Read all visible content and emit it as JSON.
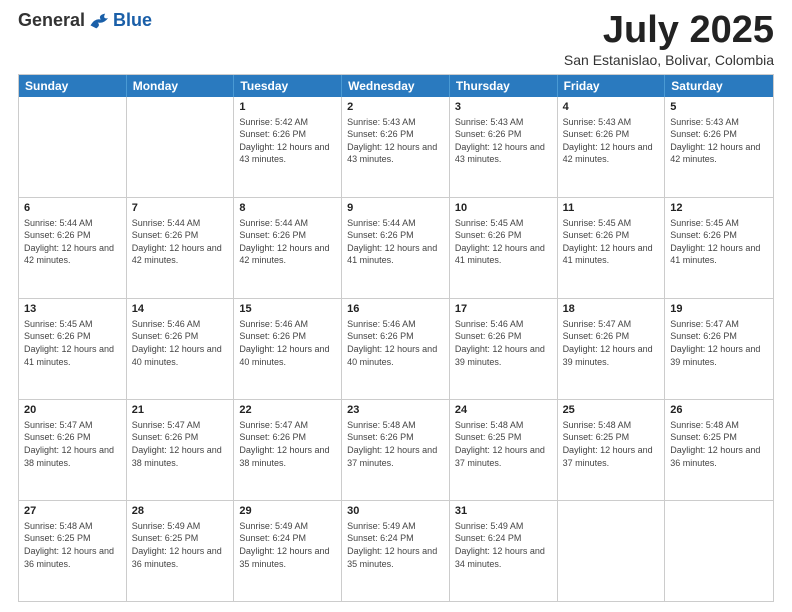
{
  "logo": {
    "general": "General",
    "blue": "Blue"
  },
  "title": "July 2025",
  "subtitle": "San Estanislao, Bolivar, Colombia",
  "header_days": [
    "Sunday",
    "Monday",
    "Tuesday",
    "Wednesday",
    "Thursday",
    "Friday",
    "Saturday"
  ],
  "weeks": [
    [
      {
        "day": "",
        "info": ""
      },
      {
        "day": "",
        "info": ""
      },
      {
        "day": "1",
        "info": "Sunrise: 5:42 AM\nSunset: 6:26 PM\nDaylight: 12 hours and 43 minutes."
      },
      {
        "day": "2",
        "info": "Sunrise: 5:43 AM\nSunset: 6:26 PM\nDaylight: 12 hours and 43 minutes."
      },
      {
        "day": "3",
        "info": "Sunrise: 5:43 AM\nSunset: 6:26 PM\nDaylight: 12 hours and 43 minutes."
      },
      {
        "day": "4",
        "info": "Sunrise: 5:43 AM\nSunset: 6:26 PM\nDaylight: 12 hours and 42 minutes."
      },
      {
        "day": "5",
        "info": "Sunrise: 5:43 AM\nSunset: 6:26 PM\nDaylight: 12 hours and 42 minutes."
      }
    ],
    [
      {
        "day": "6",
        "info": "Sunrise: 5:44 AM\nSunset: 6:26 PM\nDaylight: 12 hours and 42 minutes."
      },
      {
        "day": "7",
        "info": "Sunrise: 5:44 AM\nSunset: 6:26 PM\nDaylight: 12 hours and 42 minutes."
      },
      {
        "day": "8",
        "info": "Sunrise: 5:44 AM\nSunset: 6:26 PM\nDaylight: 12 hours and 42 minutes."
      },
      {
        "day": "9",
        "info": "Sunrise: 5:44 AM\nSunset: 6:26 PM\nDaylight: 12 hours and 41 minutes."
      },
      {
        "day": "10",
        "info": "Sunrise: 5:45 AM\nSunset: 6:26 PM\nDaylight: 12 hours and 41 minutes."
      },
      {
        "day": "11",
        "info": "Sunrise: 5:45 AM\nSunset: 6:26 PM\nDaylight: 12 hours and 41 minutes."
      },
      {
        "day": "12",
        "info": "Sunrise: 5:45 AM\nSunset: 6:26 PM\nDaylight: 12 hours and 41 minutes."
      }
    ],
    [
      {
        "day": "13",
        "info": "Sunrise: 5:45 AM\nSunset: 6:26 PM\nDaylight: 12 hours and 41 minutes."
      },
      {
        "day": "14",
        "info": "Sunrise: 5:46 AM\nSunset: 6:26 PM\nDaylight: 12 hours and 40 minutes."
      },
      {
        "day": "15",
        "info": "Sunrise: 5:46 AM\nSunset: 6:26 PM\nDaylight: 12 hours and 40 minutes."
      },
      {
        "day": "16",
        "info": "Sunrise: 5:46 AM\nSunset: 6:26 PM\nDaylight: 12 hours and 40 minutes."
      },
      {
        "day": "17",
        "info": "Sunrise: 5:46 AM\nSunset: 6:26 PM\nDaylight: 12 hours and 39 minutes."
      },
      {
        "day": "18",
        "info": "Sunrise: 5:47 AM\nSunset: 6:26 PM\nDaylight: 12 hours and 39 minutes."
      },
      {
        "day": "19",
        "info": "Sunrise: 5:47 AM\nSunset: 6:26 PM\nDaylight: 12 hours and 39 minutes."
      }
    ],
    [
      {
        "day": "20",
        "info": "Sunrise: 5:47 AM\nSunset: 6:26 PM\nDaylight: 12 hours and 38 minutes."
      },
      {
        "day": "21",
        "info": "Sunrise: 5:47 AM\nSunset: 6:26 PM\nDaylight: 12 hours and 38 minutes."
      },
      {
        "day": "22",
        "info": "Sunrise: 5:47 AM\nSunset: 6:26 PM\nDaylight: 12 hours and 38 minutes."
      },
      {
        "day": "23",
        "info": "Sunrise: 5:48 AM\nSunset: 6:26 PM\nDaylight: 12 hours and 37 minutes."
      },
      {
        "day": "24",
        "info": "Sunrise: 5:48 AM\nSunset: 6:25 PM\nDaylight: 12 hours and 37 minutes."
      },
      {
        "day": "25",
        "info": "Sunrise: 5:48 AM\nSunset: 6:25 PM\nDaylight: 12 hours and 37 minutes."
      },
      {
        "day": "26",
        "info": "Sunrise: 5:48 AM\nSunset: 6:25 PM\nDaylight: 12 hours and 36 minutes."
      }
    ],
    [
      {
        "day": "27",
        "info": "Sunrise: 5:48 AM\nSunset: 6:25 PM\nDaylight: 12 hours and 36 minutes."
      },
      {
        "day": "28",
        "info": "Sunrise: 5:49 AM\nSunset: 6:25 PM\nDaylight: 12 hours and 36 minutes."
      },
      {
        "day": "29",
        "info": "Sunrise: 5:49 AM\nSunset: 6:24 PM\nDaylight: 12 hours and 35 minutes."
      },
      {
        "day": "30",
        "info": "Sunrise: 5:49 AM\nSunset: 6:24 PM\nDaylight: 12 hours and 35 minutes."
      },
      {
        "day": "31",
        "info": "Sunrise: 5:49 AM\nSunset: 6:24 PM\nDaylight: 12 hours and 34 minutes."
      },
      {
        "day": "",
        "info": ""
      },
      {
        "day": "",
        "info": ""
      }
    ]
  ]
}
